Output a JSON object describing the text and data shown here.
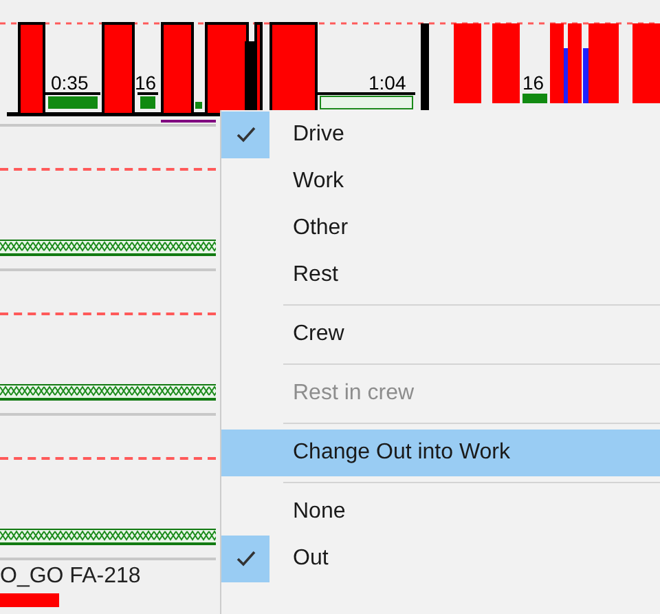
{
  "timeline": {
    "labels": [
      {
        "text": "0:35"
      },
      {
        "text": "16"
      },
      {
        "text": "1:04"
      },
      {
        "text": "16"
      }
    ]
  },
  "lanes": [
    {
      "kind": "hatched"
    },
    {
      "kind": "hatched"
    },
    {
      "kind": "hatched"
    }
  ],
  "bottom_lane": {
    "label": "O_GO FA-218"
  },
  "context_menu": {
    "items": [
      {
        "kind": "item",
        "label": "Drive",
        "checked": true,
        "disabled": false,
        "selected": false
      },
      {
        "kind": "item",
        "label": "Work",
        "checked": false,
        "disabled": false,
        "selected": false
      },
      {
        "kind": "item",
        "label": "Other",
        "checked": false,
        "disabled": false,
        "selected": false
      },
      {
        "kind": "item",
        "label": "Rest",
        "checked": false,
        "disabled": false,
        "selected": false
      },
      {
        "kind": "separator"
      },
      {
        "kind": "item",
        "label": "Crew",
        "checked": false,
        "disabled": false,
        "selected": false
      },
      {
        "kind": "separator"
      },
      {
        "kind": "item",
        "label": "Rest in crew",
        "checked": false,
        "disabled": true,
        "selected": false
      },
      {
        "kind": "separator"
      },
      {
        "kind": "item",
        "label": "Change Out into Work",
        "checked": false,
        "disabled": false,
        "selected": true
      },
      {
        "kind": "separator"
      },
      {
        "kind": "item",
        "label": "None",
        "checked": false,
        "disabled": false,
        "selected": false
      },
      {
        "kind": "item",
        "label": "Out",
        "checked": true,
        "disabled": false,
        "selected": false
      }
    ]
  }
}
